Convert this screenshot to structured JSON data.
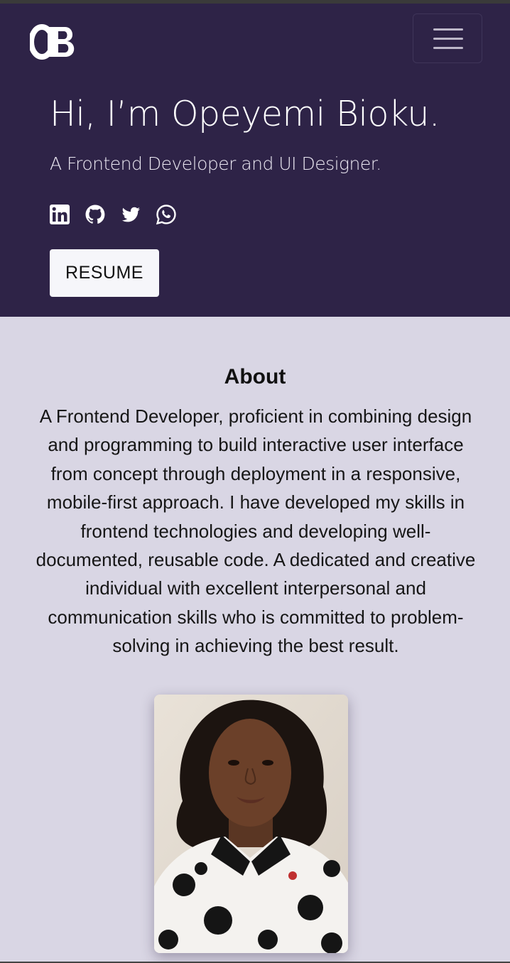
{
  "header": {
    "logo_text": "OB",
    "menu_icon": "hamburger-menu-icon"
  },
  "hero": {
    "title": "Hi, I’m Opeyemi Bioku.",
    "subtitle": "A Frontend Developer and UI Designer.",
    "social_icons": [
      "linkedin-icon",
      "github-icon",
      "twitter-icon",
      "whatsapp-icon"
    ],
    "resume_label": "RESUME"
  },
  "about": {
    "title": "About",
    "text_lines": [
      "A Frontend Developer, proficient in combining design",
      "and programming to build interactive user interface",
      "from concept through deployment in a responsive,",
      "mobile-first approach. I have developed my skills in",
      "frontend technologies and developing well-",
      "documented, reusable code. A dedicated and creative",
      "individual with excellent interpersonal and",
      "communication skills who is committed to problem-",
      "solving in achieving the best result."
    ]
  },
  "colors": {
    "hero_bg": "#2e2347",
    "page_bg": "#d9d6e4",
    "button_bg": "#f6f6fa"
  }
}
